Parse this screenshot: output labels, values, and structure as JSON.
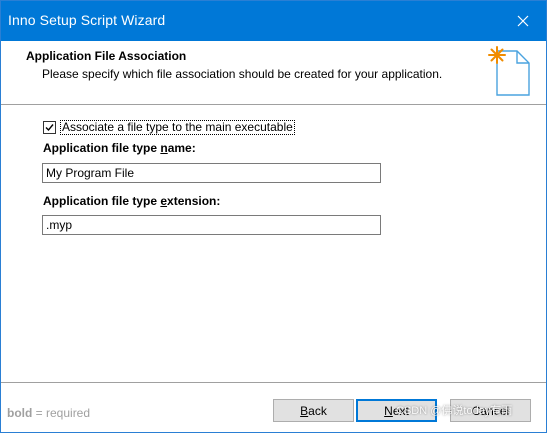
{
  "window": {
    "title": "Inno Setup Script Wizard"
  },
  "header": {
    "title": "Application File Association",
    "subtitle": "Please specify which file association should be created for your application.",
    "icon": "wizard-document-sparkle-icon"
  },
  "form": {
    "associate_checkbox": {
      "label": "Associate a file type to the main executable",
      "checked": true
    },
    "name_field": {
      "label_pre": "Application file type ",
      "label_accel": "n",
      "label_post": "ame:",
      "value": "My Program File"
    },
    "extension_field": {
      "label_pre": "Application file type ",
      "label_accel": "e",
      "label_post": "xtension:",
      "value": ".myp"
    }
  },
  "footer": {
    "note_bold": "bold",
    "note_rest": " = required",
    "back_button": {
      "accel": "B",
      "rest": "ack"
    },
    "next_button": {
      "accel": "N",
      "rest": "ext"
    },
    "cancel_button": {
      "label": "Cancel"
    }
  },
  "watermark": "CSDN @佛说today有雨",
  "colors": {
    "titlebar": "#0078d7",
    "button_face": "#e1e1e1",
    "default_button_border": "#0078d7",
    "note_gray": "#a0a0a0",
    "icon_star": "#f08c00",
    "icon_doc": "#4aa3df"
  }
}
